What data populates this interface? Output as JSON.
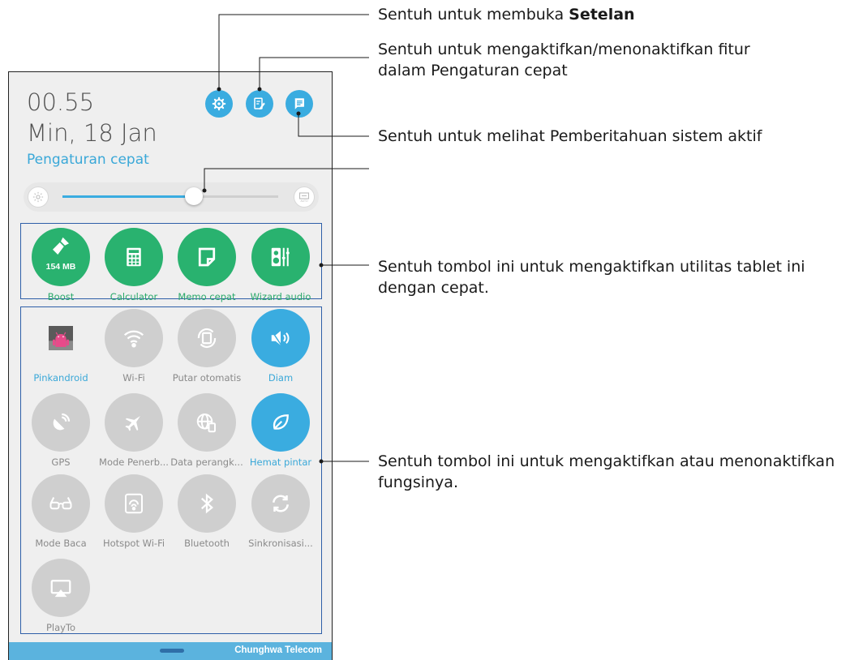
{
  "status": {
    "time": "00.55",
    "date": "Min, 18 Jan"
  },
  "quick_settings": {
    "title": "Pengaturan cepat"
  },
  "brightness": {
    "level": 0.61,
    "auto_label": "AUTO"
  },
  "utilities": [
    {
      "label": "Boost",
      "badge": "154 MB",
      "icon": "broom-icon"
    },
    {
      "label": "Calculator",
      "icon": "calculator-icon"
    },
    {
      "label": "Memo cepat",
      "icon": "memo-icon"
    },
    {
      "label": "Wizard audio",
      "icon": "audio-wizard-icon"
    }
  ],
  "toggles": [
    {
      "label": "Pinkandroid",
      "state": "avatar",
      "icon": "avatar-icon"
    },
    {
      "label": "Wi-Fi",
      "state": "off",
      "icon": "wifi-icon"
    },
    {
      "label": "Putar otomatis",
      "state": "off",
      "icon": "auto-rotate-icon"
    },
    {
      "label": "Diam",
      "state": "on",
      "icon": "silent-icon"
    },
    {
      "label": "GPS",
      "state": "off",
      "icon": "gps-icon"
    },
    {
      "label": "Mode Penerb...",
      "state": "off",
      "icon": "airplane-icon"
    },
    {
      "label": "Data perangk...",
      "state": "off",
      "icon": "mobile-data-icon"
    },
    {
      "label": "Hemat pintar",
      "state": "on",
      "icon": "leaf-icon"
    },
    {
      "label": "Mode Baca",
      "state": "off",
      "icon": "reading-glasses-icon"
    },
    {
      "label": "Hotspot Wi-Fi",
      "state": "off",
      "icon": "hotspot-icon"
    },
    {
      "label": "Bluetooth",
      "state": "off",
      "icon": "bluetooth-icon"
    },
    {
      "label": "Sinkronisasi...",
      "state": "off",
      "icon": "sync-icon"
    },
    {
      "label": "PlayTo",
      "state": "off",
      "icon": "playto-icon"
    }
  ],
  "navbar": {
    "carrier": "Chunghwa Telecom"
  },
  "callouts": {
    "settings_prefix": "Sentuh untuk membuka ",
    "settings_bold": "Setelan",
    "edit_line1": "Sentuh untuk mengaktifkan/menonaktifkan fitur",
    "edit_line2": "dalam Pengaturan cepat",
    "notifications": "Sentuh untuk melihat Pemberitahuan sistem aktif",
    "utilities_line1": "Sentuh tombol ini untuk mengaktifkan utilitas tablet ini",
    "utilities_line2": "dengan cepat.",
    "toggles_line1": "Sentuh tombol ini untuk mengaktifkan atau menonaktifkan",
    "toggles_line2": "fungsinya."
  },
  "colors": {
    "accent_blue": "#3aace0",
    "utility_green": "#29b26f",
    "inactive_gray": "#cfcfcf",
    "callout_box": "#2e5fa8"
  }
}
